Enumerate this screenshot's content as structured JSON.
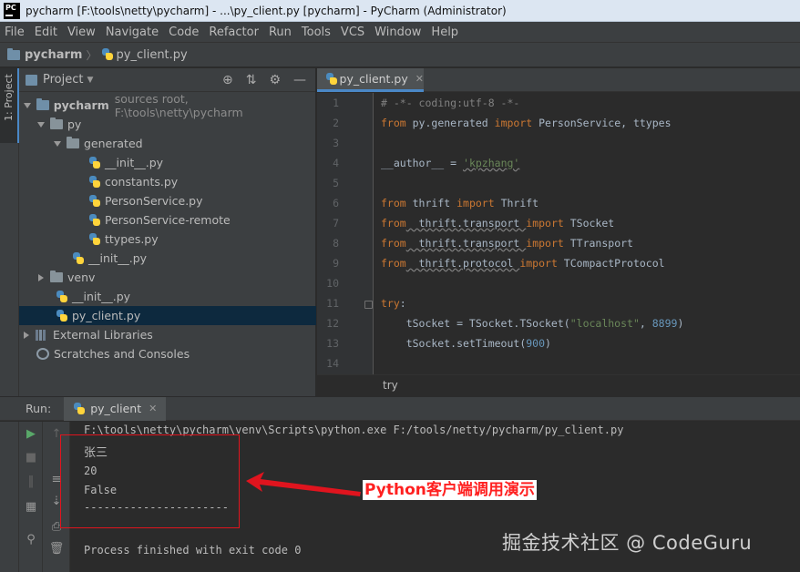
{
  "window": {
    "title": "pycharm [F:\\tools\\netty\\pycharm] - ...\\py_client.py [pycharm] - PyCharm (Administrator)",
    "logo_text": "PC"
  },
  "menu": [
    "File",
    "Edit",
    "View",
    "Navigate",
    "Code",
    "Refactor",
    "Run",
    "Tools",
    "VCS",
    "Window",
    "Help"
  ],
  "navbar": {
    "root": "pycharm",
    "file": "py_client.py"
  },
  "left_strip": {
    "tab_label": "1: Project"
  },
  "project_panel": {
    "title": "Project",
    "tree": [
      {
        "label": "pycharm",
        "sub": "sources root,  F:\\tools\\netty\\pycharm"
      },
      {
        "label": "py"
      },
      {
        "label": "generated"
      },
      {
        "label": "__init__.py"
      },
      {
        "label": "constants.py"
      },
      {
        "label": "PersonService.py"
      },
      {
        "label": "PersonService-remote"
      },
      {
        "label": "ttypes.py"
      },
      {
        "label": "__init__.py"
      },
      {
        "label": "venv"
      },
      {
        "label": "__init__.py"
      },
      {
        "label": "py_client.py"
      },
      {
        "label": "External Libraries"
      },
      {
        "label": "Scratches and Consoles"
      }
    ]
  },
  "editor": {
    "tab": "py_client.py",
    "line_numbers": [
      "1",
      "2",
      "3",
      "4",
      "5",
      "6",
      "7",
      "8",
      "9",
      "10",
      "11",
      "12",
      "13",
      "14"
    ],
    "lines": {
      "l1": "# -*- coding:utf-8 -*-",
      "l2_kw1": "from",
      "l2_mod": " py.generated ",
      "l2_kw2": "import",
      "l2_rest": " PersonService, ttypes",
      "l4_name": "__author__",
      "l4_eq": " = ",
      "l4_str": "'kpzhang'",
      "l6_kw1": "from",
      "l6_mod": " thrift ",
      "l6_kw2": "import",
      "l6_rest": " Thrift",
      "l7_kw1": "from",
      "l7_mod": "  thrift.transport ",
      "l7_kw2": "import",
      "l7_rest": " TSocket",
      "l8_kw1": "from",
      "l8_mod": "  thrift.transport ",
      "l8_kw2": "import",
      "l8_rest": " TTransport",
      "l9_kw1": "from",
      "l9_mod": "  thrift.protocol ",
      "l9_kw2": "import",
      "l9_rest": " TCompactProtocol",
      "l11_kw": "try",
      "l11_colon": ":",
      "l12_a": "    tSocket = TSocket.TSocket(",
      "l12_str": "\"localhost\"",
      "l12_comma": ", ",
      "l12_num": "8899",
      "l12_close": ")",
      "l13_a": "    tSocket.setTimeout(",
      "l13_num": "900",
      "l13_close": ")"
    },
    "breadcrumb": "try"
  },
  "run_panel": {
    "label": "Run:",
    "tab": "py_client",
    "output": [
      "F:\\tools\\netty\\pycharm\\venv\\Scripts\\python.exe F:/tools/netty/pycharm/py_client.py",
      "张三",
      "20",
      "False",
      "----------------------",
      "Process finished with exit code 0"
    ]
  },
  "annotation": {
    "text": "Python客户端调用演示",
    "color": "#e0141e"
  },
  "watermark": "掘金技术社区 @ CodeGuru"
}
